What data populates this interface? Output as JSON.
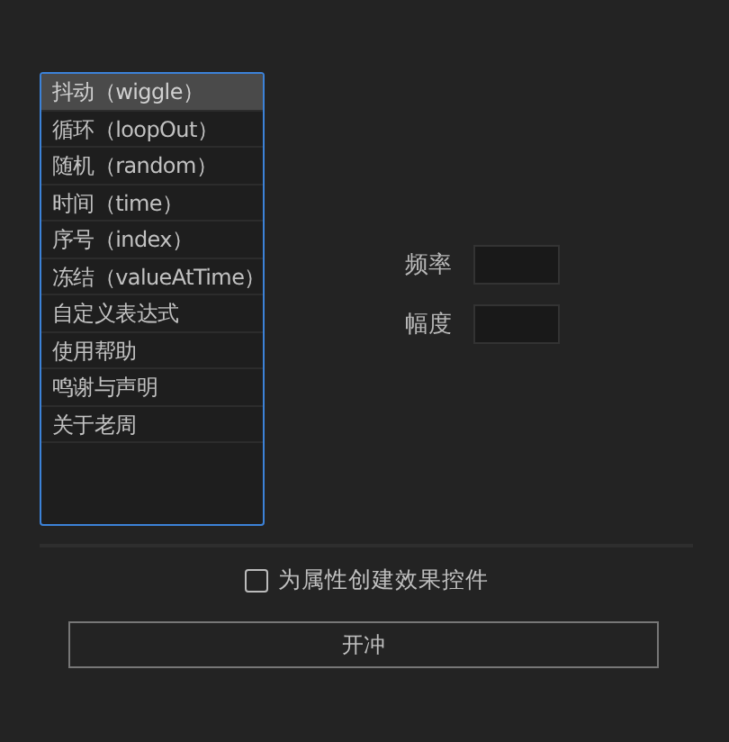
{
  "list": {
    "items": [
      {
        "label": "抖动（wiggle）",
        "selected": true
      },
      {
        "label": "循环（loopOut）",
        "selected": false
      },
      {
        "label": "随机（random）",
        "selected": false
      },
      {
        "label": "时间（time）",
        "selected": false
      },
      {
        "label": "序号（index）",
        "selected": false
      },
      {
        "label": "冻结（valueAtTime）",
        "selected": false
      },
      {
        "label": "自定义表达式",
        "selected": false
      },
      {
        "label": "使用帮助",
        "selected": false
      },
      {
        "label": "鸣谢与声明",
        "selected": false
      },
      {
        "label": "关于老周",
        "selected": false
      }
    ]
  },
  "fields": [
    {
      "label": "频率"
    },
    {
      "label": "幅度"
    }
  ],
  "checkbox": {
    "label": "为属性创建效果控件",
    "checked": false
  },
  "button": {
    "label": "开冲"
  }
}
